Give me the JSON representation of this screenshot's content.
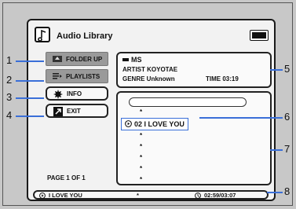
{
  "header": {
    "title": "Audio Library"
  },
  "buttons": {
    "folder_up": "FOLDER UP",
    "playlists": "PLAYLISTS",
    "info": "INFO",
    "exit": "EXIT"
  },
  "page_indicator": "PAGE  1  OF  1",
  "track_info": {
    "name": "MS",
    "artist": "ARTIST KOYOTAE",
    "genre": "GENRE Unknown",
    "time": "TIME  03:19"
  },
  "list": {
    "placeholder_char": "*",
    "selected_item": "02  I LOVE YOU"
  },
  "status": {
    "track": "I LOVE YOU",
    "star": "*",
    "time": "02:59/03:07"
  },
  "callouts": [
    "1",
    "2",
    "3",
    "4",
    "5",
    "6",
    "7",
    "8"
  ]
}
